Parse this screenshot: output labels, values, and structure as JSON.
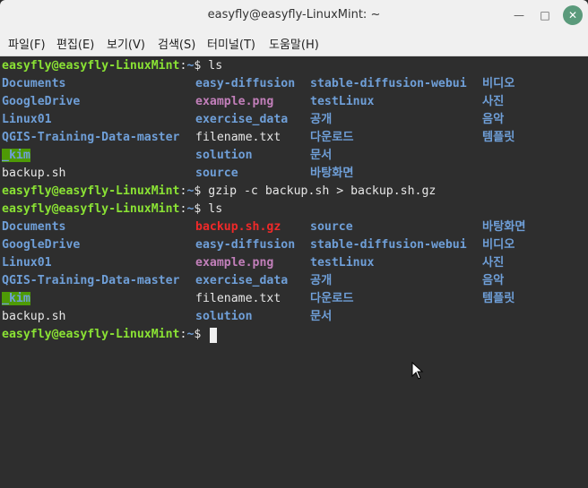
{
  "window": {
    "title": "easyfly@easyfly-LinuxMint: ~"
  },
  "menu": [
    "파일(F)",
    "편집(E)",
    "보기(V)",
    "검색(S)",
    "터미널(T)",
    "도움말(H)"
  ],
  "prompt": {
    "user": "easyfly@easyfly-LinuxMint",
    "colon": ":",
    "path": "~",
    "sign": "$"
  },
  "commands": [
    "ls",
    "gzip -c backup.sh > backup.sh.gz",
    "ls",
    ""
  ],
  "listing1": [
    [
      "Documents",
      "easy-diffusion",
      "stable-diffusion-webui",
      "비디오"
    ],
    [
      "GoogleDrive",
      "example.png",
      "testLinux",
      "사진"
    ],
    [
      "Linux01",
      "exercise_data",
      "공개",
      "음악"
    ],
    [
      "QGIS-Training-Data-master",
      "filename.txt",
      "다운로드",
      "템플릿"
    ],
    [
      "_kim",
      "solution",
      "문서",
      ""
    ],
    [
      "backup.sh",
      "source",
      "바탕화면",
      ""
    ]
  ],
  "listing2": [
    [
      "Documents",
      "backup.sh.gz",
      "source",
      "바탕화면"
    ],
    [
      "GoogleDrive",
      "easy-diffusion",
      "stable-diffusion-webui",
      "비디오"
    ],
    [
      "Linux01",
      "example.png",
      "testLinux",
      "사진"
    ],
    [
      "QGIS-Training-Data-master",
      "exercise_data",
      "공개",
      "음악"
    ],
    [
      "_kim",
      "filename.txt",
      "다운로드",
      "템플릿"
    ],
    [
      "backup.sh",
      "solution",
      "문서",
      ""
    ]
  ],
  "types1": [
    [
      "dir",
      "dir",
      "dir",
      "dir"
    ],
    [
      "dir",
      "img",
      "dir",
      "dir"
    ],
    [
      "dir",
      "dir",
      "dir",
      "dir"
    ],
    [
      "dir",
      "file",
      "dir",
      "dir"
    ],
    [
      "hl",
      "dir",
      "dir",
      ""
    ],
    [
      "file",
      "dir",
      "dir",
      ""
    ]
  ],
  "types2": [
    [
      "dir",
      "arc",
      "dir",
      "dir"
    ],
    [
      "dir",
      "dir",
      "dir",
      "dir"
    ],
    [
      "dir",
      "img",
      "dir",
      "dir"
    ],
    [
      "dir",
      "dir",
      "dir",
      "dir"
    ],
    [
      "hl",
      "file",
      "dir",
      "dir"
    ],
    [
      "file",
      "dir",
      "dir",
      ""
    ]
  ],
  "colors": {
    "prompt_user": "#8ae234",
    "directory": "#6f9fd8",
    "image": "#c27fba",
    "archive": "#ef2929",
    "highlight_bg": "#4e9a06"
  }
}
